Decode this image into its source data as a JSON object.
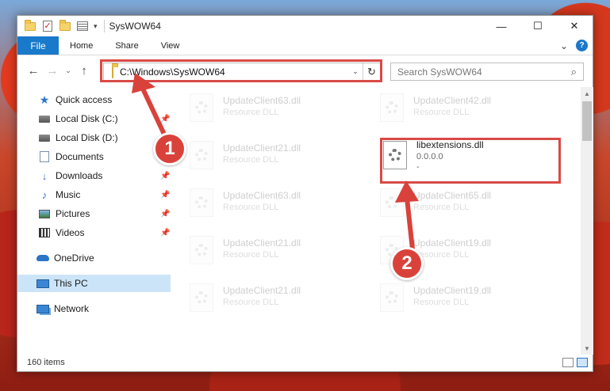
{
  "window": {
    "title": "SysWOW64",
    "controls": {
      "minimize": "—",
      "maximize": "☐",
      "close": "✕"
    }
  },
  "ribbon": {
    "tabs": [
      "File",
      "Home",
      "Share",
      "View"
    ],
    "expand": "⌄",
    "help": "?"
  },
  "address": {
    "path": "C:\\Windows\\SysWOW64",
    "dropdown": "⌄",
    "refresh": "↻"
  },
  "search": {
    "placeholder": "Search SysWOW64",
    "icon": "search-icon"
  },
  "nav": {
    "back": "←",
    "forward": "→",
    "recent": "⌄",
    "up": "↑",
    "items": [
      {
        "label": "Quick access",
        "icon": "star-icon"
      },
      {
        "label": "Local Disk (C:)",
        "icon": "drive-icon"
      },
      {
        "label": "Local Disk (D:)",
        "icon": "drive-icon"
      },
      {
        "label": "Documents",
        "icon": "documents-icon"
      },
      {
        "label": "Downloads",
        "icon": "downloads-icon"
      },
      {
        "label": "Music",
        "icon": "music-icon"
      },
      {
        "label": "Pictures",
        "icon": "pictures-icon"
      },
      {
        "label": "Videos",
        "icon": "videos-icon"
      },
      {
        "label": "OneDrive",
        "icon": "onedrive-icon"
      },
      {
        "label": "This PC",
        "icon": "this-pc-icon",
        "selected": true
      },
      {
        "label": "Network",
        "icon": "network-icon"
      }
    ],
    "pin_glyph": "📌"
  },
  "files": [
    {
      "name": "UpdateClient63.dll",
      "type": "Resource DLL"
    },
    {
      "name": "UpdateClient42.dll",
      "type": "Resource DLL"
    },
    {
      "name": "UpdateClient21.dll",
      "type": "Resource DLL"
    },
    {
      "name": "libextensions.dll",
      "version": "0.0.0.0",
      "extra": "-",
      "active": true
    },
    {
      "name": "UpdateClient63.dll",
      "type": "Resource DLL"
    },
    {
      "name": "UpdateClient65.dll",
      "type": "Resource DLL"
    },
    {
      "name": "UpdateClient21.dll",
      "type": "Resource DLL"
    },
    {
      "name": "UpdateClient19.dll",
      "type": "Resource DLL"
    },
    {
      "name": "UpdateClient21.dll",
      "type": "Resource DLL"
    },
    {
      "name": "UpdateClient19.dll",
      "type": "Resource DLL"
    }
  ],
  "status": {
    "count": "160 items"
  },
  "annotations": {
    "badge1": "1",
    "badge2": "2",
    "color": "#d9423b"
  }
}
